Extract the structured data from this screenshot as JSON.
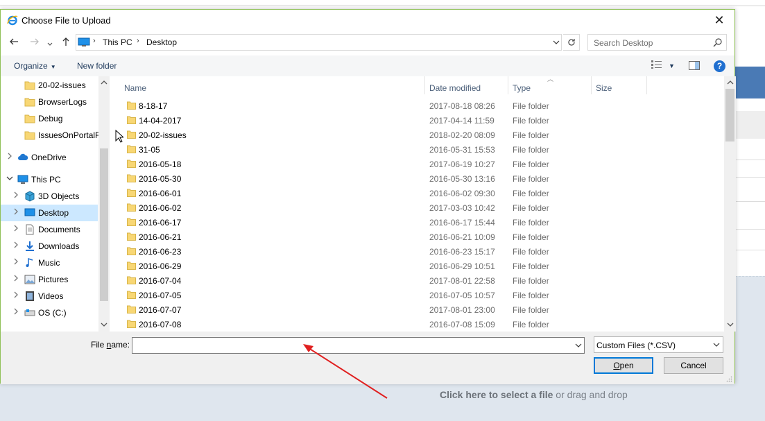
{
  "dialog": {
    "title": "Choose File to Upload",
    "close": "✕"
  },
  "address": {
    "crumbs": [
      "This PC",
      "Desktop"
    ],
    "search_placeholder": "Search Desktop"
  },
  "toolbar": {
    "organize": "Organize",
    "new_folder": "New folder",
    "help": "?"
  },
  "nav": {
    "items": [
      {
        "label": "20-02-issues",
        "icon": "folder-icon",
        "chevron": ""
      },
      {
        "label": "BrowserLogs",
        "icon": "folder-icon",
        "chevron": ""
      },
      {
        "label": "Debug",
        "icon": "folder-icon",
        "chevron": ""
      },
      {
        "label": "IssuesOnPortalFi",
        "icon": "folder-icon",
        "chevron": ""
      },
      {
        "label": "OneDrive",
        "icon": "cloud-icon",
        "chevron": ">"
      },
      {
        "label": "This PC",
        "icon": "computer-icon",
        "chevron": "v"
      },
      {
        "label": "3D Objects",
        "icon": "cube-icon",
        "chevron": ">"
      },
      {
        "label": "Desktop",
        "icon": "desktop-icon",
        "chevron": ">"
      },
      {
        "label": "Documents",
        "icon": "document-icon",
        "chevron": ">"
      },
      {
        "label": "Downloads",
        "icon": "download-icon",
        "chevron": ">"
      },
      {
        "label": "Music",
        "icon": "music-icon",
        "chevron": ">"
      },
      {
        "label": "Pictures",
        "icon": "picture-icon",
        "chevron": ">"
      },
      {
        "label": "Videos",
        "icon": "video-icon",
        "chevron": ">"
      },
      {
        "label": "OS (C:)",
        "icon": "drive-icon",
        "chevron": ">"
      }
    ],
    "selected": "Desktop"
  },
  "columns": {
    "name": "Name",
    "date": "Date modified",
    "type": "Type",
    "size": "Size"
  },
  "files": [
    {
      "name": "8-18-17",
      "date": "2017-08-18 08:26",
      "type": "File folder"
    },
    {
      "name": "14-04-2017",
      "date": "2017-04-14 11:59",
      "type": "File folder"
    },
    {
      "name": "20-02-issues",
      "date": "2018-02-20 08:09",
      "type": "File folder"
    },
    {
      "name": "31-05",
      "date": "2016-05-31 15:53",
      "type": "File folder"
    },
    {
      "name": "2016-05-18",
      "date": "2017-06-19 10:27",
      "type": "File folder"
    },
    {
      "name": "2016-05-30",
      "date": "2016-05-30 13:16",
      "type": "File folder"
    },
    {
      "name": "2016-06-01",
      "date": "2016-06-02 09:30",
      "type": "File folder"
    },
    {
      "name": "2016-06-02",
      "date": "2017-03-03 10:42",
      "type": "File folder"
    },
    {
      "name": "2016-06-17",
      "date": "2016-06-17 15:44",
      "type": "File folder"
    },
    {
      "name": "2016-06-21",
      "date": "2016-06-21 10:09",
      "type": "File folder"
    },
    {
      "name": "2016-06-23",
      "date": "2016-06-23 15:17",
      "type": "File folder"
    },
    {
      "name": "2016-06-29",
      "date": "2016-06-29 10:51",
      "type": "File folder"
    },
    {
      "name": "2016-07-04",
      "date": "2017-08-01 22:58",
      "type": "File folder"
    },
    {
      "name": "2016-07-05",
      "date": "2016-07-05 10:57",
      "type": "File folder"
    },
    {
      "name": "2016-07-07",
      "date": "2017-08-01 23:00",
      "type": "File folder"
    },
    {
      "name": "2016-07-08",
      "date": "2016-07-08 15:09",
      "type": "File folder"
    }
  ],
  "bottom": {
    "file_name_label_pre": "File ",
    "file_name_label_u": "n",
    "file_name_label_post": "ame:",
    "file_name_value": "",
    "filter": "Custom Files (*.CSV)",
    "open_u": "O",
    "open_rest": "pen",
    "cancel": "Cancel"
  },
  "background": {
    "drop_bold": "Click here to select a file",
    "drop_rest": " or drag and drop"
  },
  "colors": {
    "selection": "#cce8ff",
    "accent": "#0078d7",
    "dialog_border": "#8fc057",
    "annotation": "#e02020"
  }
}
